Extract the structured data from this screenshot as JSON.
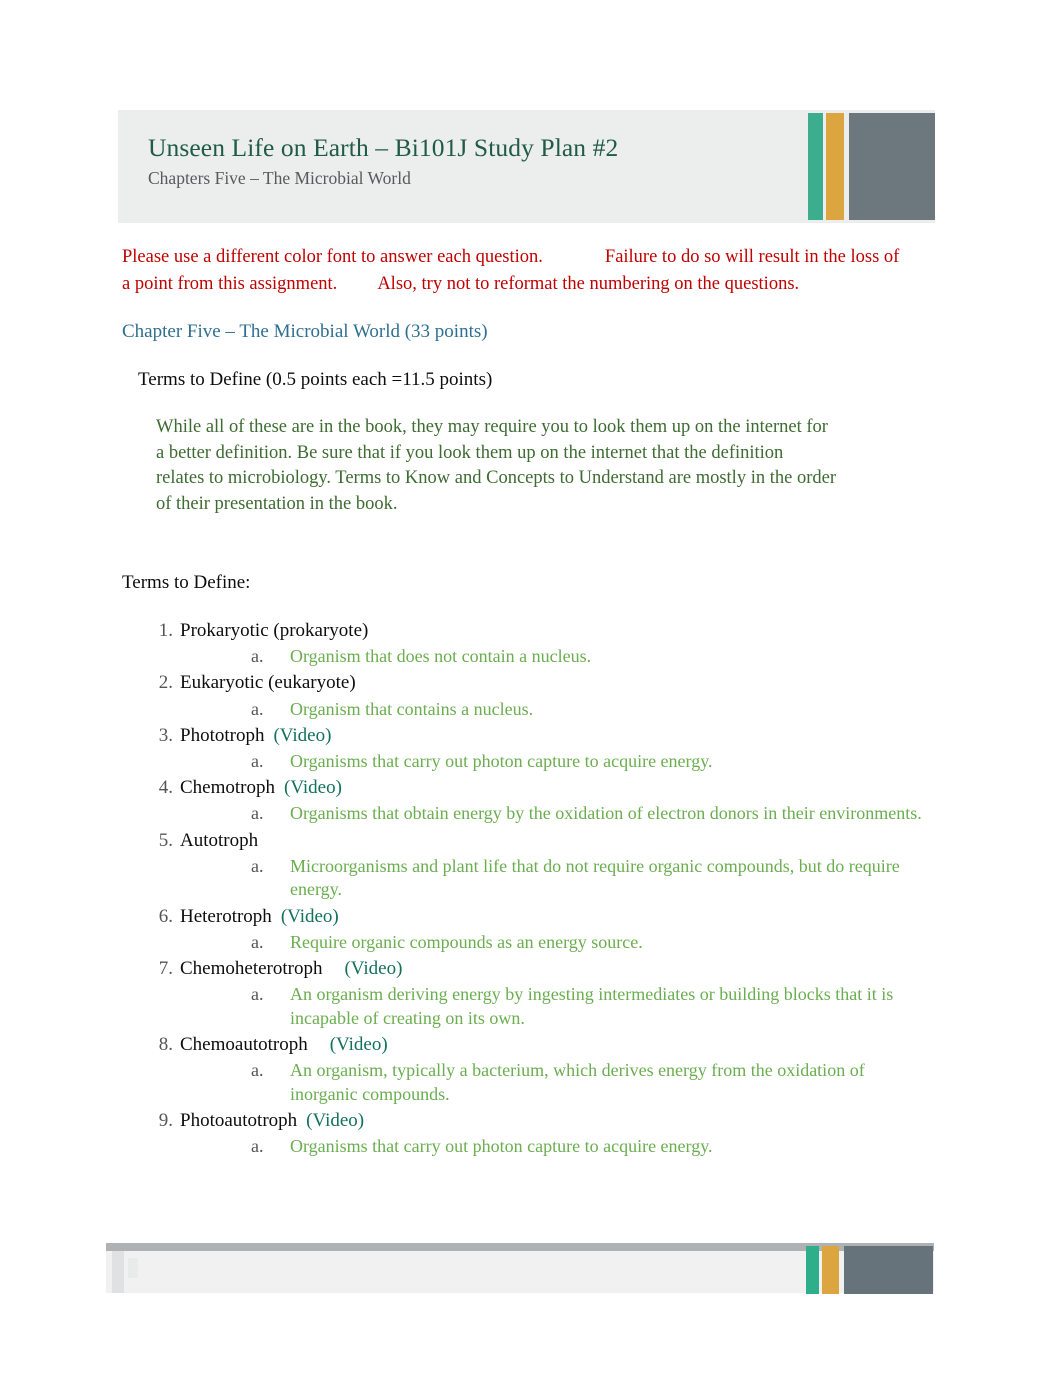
{
  "header": {
    "title": "Unseen Life on Earth – Bi101J Study Plan #2",
    "subtitle": "Chapters Five – The Microbial World",
    "accent_colors": {
      "teal": "#3cae8d",
      "gold": "#dda53f",
      "gray": "#6c787e"
    },
    "band_color": "#eceded",
    "title_color": "#1f5b45",
    "subtitle_color": "#57595b"
  },
  "warning": {
    "part1": "Please use a different color font to answer each question.",
    "part2": "Failure to do so will result in the loss of a point from this assignment.",
    "part3": "Also, try not to reformat the numbering on the questions.",
    "color": "#c00000"
  },
  "chapter": {
    "heading": "Chapter Five – The Microbial World (33 points)",
    "heading_color": "#2e6f90",
    "terms_points": "Terms to Define (0.5 points each =11.5 points)",
    "intro": "While all of these are in the book, they may require you to look them up on the internet for a better definition. Be sure that if you look them up on the internet that the definition relates to microbiology. Terms to Know and Concepts to Understand are mostly in the order of their presentation in the book.",
    "intro_color": "#3d6b31",
    "terms_label": "Terms to Define:"
  },
  "list": {
    "answer_color": "#6aae4f",
    "video_color": "#13715b",
    "video_label": "(Video)",
    "answer_letter": "a.",
    "items": [
      {
        "num": "1.",
        "term": "Prokaryotic (prokaryote)",
        "video": false,
        "answer": "Organism that does not contain a nucleus."
      },
      {
        "num": "2.",
        "term": "Eukaryotic (eukaryote)",
        "video": false,
        "answer": "Organism that contains a nucleus."
      },
      {
        "num": "3.",
        "term": "Phototroph",
        "video": true,
        "answer": "Organisms that carry out photon capture to acquire energy."
      },
      {
        "num": "4.",
        "term": "Chemotroph",
        "video": true,
        "answer": "Organisms that obtain energy by the oxidation of electron donors in their environments."
      },
      {
        "num": "5.",
        "term": "Autotroph",
        "video": false,
        "answer": "Microorganisms and plant life that do not require organic compounds, but do require energy."
      },
      {
        "num": "6.",
        "term": "Heterotroph",
        "video": true,
        "answer": "Require organic compounds as an energy source."
      },
      {
        "num": "7.",
        "term": "Chemoheterotroph",
        "video": true,
        "answer": "An organism deriving energy by ingesting intermediates or building blocks that it is incapable of creating on its own."
      },
      {
        "num": "8.",
        "term": "Chemoautotroph",
        "video": true,
        "answer": "An organism, typically a bacterium, which derives energy from the oxidation of inorganic compounds."
      },
      {
        "num": "9.",
        "term": "Photoautotroph",
        "video": true,
        "answer": "Organisms that carry out photon capture to acquire energy."
      }
    ]
  },
  "footer": {
    "band_color": "#f1f1f1",
    "rule_color": "#aeb2b4",
    "accent_colors": {
      "teal": "#2fae8b",
      "gold": "#dda53f",
      "gray": "#67737a"
    }
  }
}
